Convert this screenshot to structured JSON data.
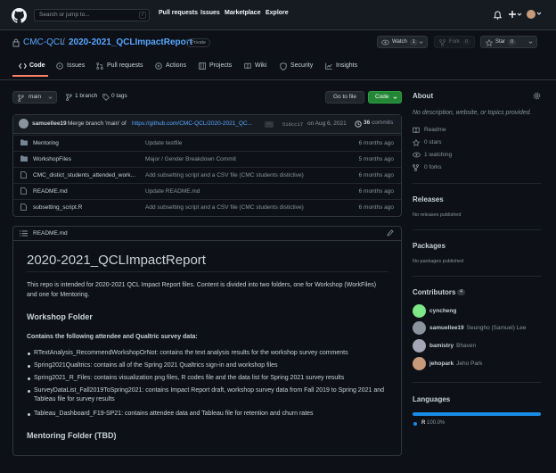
{
  "header": {
    "search_placeholder": "Search or jump to...",
    "search_key": "/",
    "nav": [
      "Pull requests",
      "Issues",
      "Marketplace",
      "Explore"
    ]
  },
  "repo": {
    "owner": "CMC-QCL",
    "separator": "/",
    "name": "2020-2021_QCLImpactReport",
    "visibility": "Private",
    "watch_label": "Watch",
    "watch_count": "1",
    "fork_label": "Fork",
    "fork_count": "0",
    "star_label": "Star",
    "star_count": "0"
  },
  "tabs": [
    "Code",
    "Issues",
    "Pull requests",
    "Actions",
    "Projects",
    "Wiki",
    "Security",
    "Insights"
  ],
  "toolbar": {
    "branch": "main",
    "branches": "1 branch",
    "tags": "0 tags",
    "goto_file": "Go to file",
    "code_button": "Code"
  },
  "commit": {
    "author": "samuellee19",
    "message_prefix": "Merge branch 'main' of",
    "message_link": "https://github.com/CMC-QCL/2020-2021_QC...",
    "ellipsis": "…",
    "sha": "516cc17",
    "date": "on Aug 6, 2021",
    "count": "36",
    "count_label": "commits"
  },
  "files": [
    {
      "name": "Mentoring",
      "type": "folder",
      "message": "Update testfile",
      "age": "6 months ago"
    },
    {
      "name": "WorkshopFiles",
      "type": "folder",
      "message": "Major / Gender Breakdown Commit",
      "age": "5 months ago"
    },
    {
      "name": "CMC_distict_students_attended_work...",
      "type": "file",
      "message": "Add subsetting script and a CSV file (CMC students distictive)",
      "age": "6 months ago"
    },
    {
      "name": "README.md",
      "type": "file",
      "message": "Update README.md",
      "age": "6 months ago"
    },
    {
      "name": "subsetting_script.R",
      "type": "file",
      "message": "Add subsetting script and a CSV file (CMC students distictive)",
      "age": "6 months ago"
    }
  ],
  "readme": {
    "filename": "README.md",
    "title": "2020-2021_QCLImpactReport",
    "intro": "This repo is intended for 2020-2021 QCL Impact Report files. Content is divided into two folders, one for Workshop (WorkFiles) and one for Mentoring.",
    "workshop_heading": "Workshop Folder",
    "contains_label": "Contains the following attendee and Qualtric survey data:",
    "items": [
      "RTextAnalysis_RecommendWorkshopOrNot: contains the text analysis results for the workshop survey comments",
      "Spring2021Qualtrics: contains all of the Spring 2021 Qualtrics sign-in and workshop files",
      "Spring2021_R_Files: contains visualization png files, R codes file and the data list for Spring 2021 survey results",
      "SurveyDataList_Fall2019ToSpring2021: contains Impact Report draft, workshop survey data from Fall 2019 to Spring 2021 and Tableau file for survey results",
      "Tableau_Dashboard_F19-SP21: contains attendee data and Tableau file for retention and churn rates"
    ],
    "mentoring_heading": "Mentoring Folder (TBD)"
  },
  "about": {
    "heading": "About",
    "description": "No description, website, or topics provided.",
    "readme": "Readme",
    "stars": "0 stars",
    "watching": "1 watching",
    "forks": "0 forks"
  },
  "releases": {
    "heading": "Releases",
    "empty": "No releases published"
  },
  "packages": {
    "heading": "Packages",
    "empty": "No packages published"
  },
  "contributors": {
    "heading": "Contributors",
    "count": "4",
    "people": [
      {
        "login": "cyncheng",
        "name": "",
        "color": "#7ee787"
      },
      {
        "login": "samuellee19",
        "name": "Seungho (Samuel) Lee",
        "color": "#8b949e"
      },
      {
        "login": "bamistry",
        "name": "Bhaven",
        "color": "#a5a5b5"
      },
      {
        "login": "jehopark",
        "name": "Jeho Park",
        "color": "#c69a7a"
      }
    ]
  },
  "languages": {
    "heading": "Languages",
    "items": [
      {
        "name": "R",
        "percent": "100.0%",
        "value": 100,
        "color": "#198ce7"
      }
    ]
  },
  "colors": {
    "accent": "#58a6ff",
    "green": "#238636",
    "tab_underline": "#f78166"
  }
}
